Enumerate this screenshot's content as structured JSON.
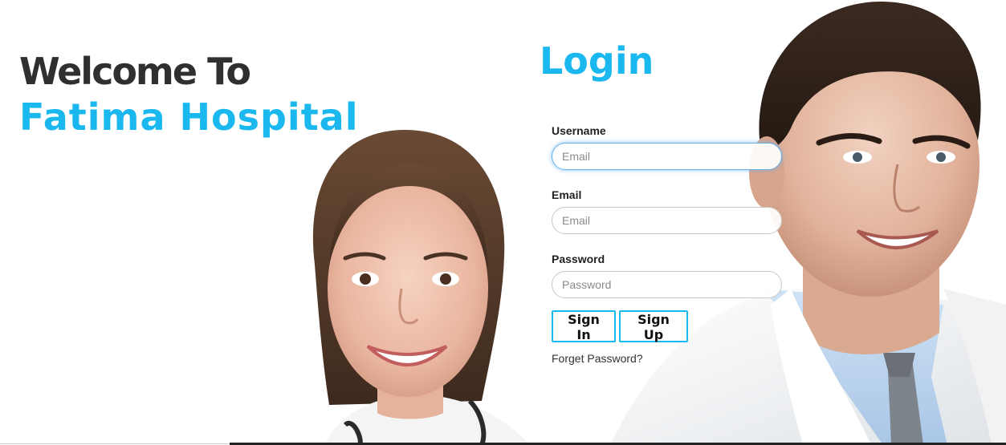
{
  "hero": {
    "welcome_line1": "Welcome To",
    "welcome_line2": "Fatima Hospital",
    "image_alt": "female-doctor and male-doctor photograph"
  },
  "login": {
    "title": "Login",
    "username": {
      "label": "Username",
      "placeholder": "Email",
      "value": ""
    },
    "email": {
      "label": "Email",
      "placeholder": "Email",
      "value": ""
    },
    "password": {
      "label": "Password",
      "placeholder": "Password",
      "value": ""
    },
    "sign_in_label": "Sign In",
    "sign_up_label": "Sign Up",
    "forgot_label": "Forget Password?"
  },
  "colors": {
    "accent": "#1ab8ee",
    "heading_dark": "#2f2f2f",
    "focus_ring": "#66afe9"
  }
}
